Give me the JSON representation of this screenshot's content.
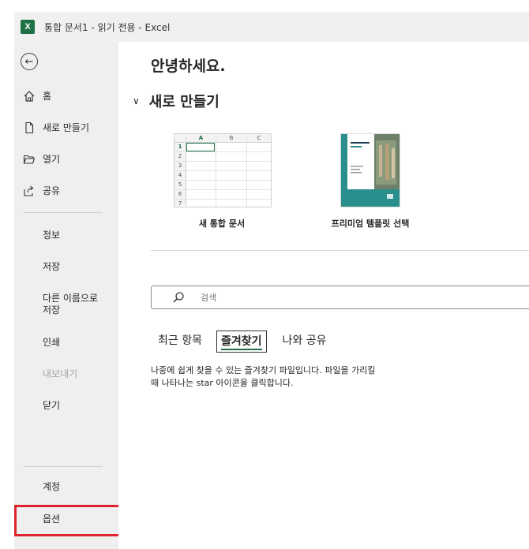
{
  "window": {
    "title": "통합 문서1  -  읽기 전용  -  Excel",
    "logo_letter": "X"
  },
  "sidebar": {
    "primary": [
      {
        "label": "홈",
        "icon": "home-icon"
      },
      {
        "label": "새로 만들기",
        "icon": "new-file-icon"
      },
      {
        "label": "열기",
        "icon": "folder-open-icon"
      },
      {
        "label": "공유",
        "icon": "share-icon"
      }
    ],
    "secondary": [
      "정보",
      "저장",
      "다른 이름으로 저장",
      "인쇄",
      "내보내기",
      "닫기"
    ],
    "bottom": [
      "계정",
      "옵션"
    ]
  },
  "main": {
    "greeting": "안녕하세요.",
    "new_section": "새로 만들기",
    "templates": [
      {
        "label": "새 통합 문서"
      },
      {
        "label": "프리미엄 템플릿 선택"
      }
    ],
    "blank_sheet": {
      "columns": [
        "A",
        "B",
        "C"
      ],
      "rows": [
        "1",
        "2",
        "3",
        "4",
        "5",
        "6",
        "7"
      ]
    },
    "premium_thumb_text": "REPORT TITLE",
    "search_placeholder": "검색",
    "tabs": [
      "최근 항목",
      "즐겨찾기",
      "나와 공유"
    ],
    "active_tab": "즐겨찾기",
    "favorites_description_line1": "나중에 쉽게 찾을 수 있는 즐겨찾기 파일입니다. 파일을 가리킬",
    "favorites_description_line2": "때 나타나는 star 아이콘을 클릭합니다."
  },
  "colors": {
    "excel_green": "#1e7145",
    "highlight_red": "#e0242f",
    "sidebar_bg": "#efefef"
  }
}
